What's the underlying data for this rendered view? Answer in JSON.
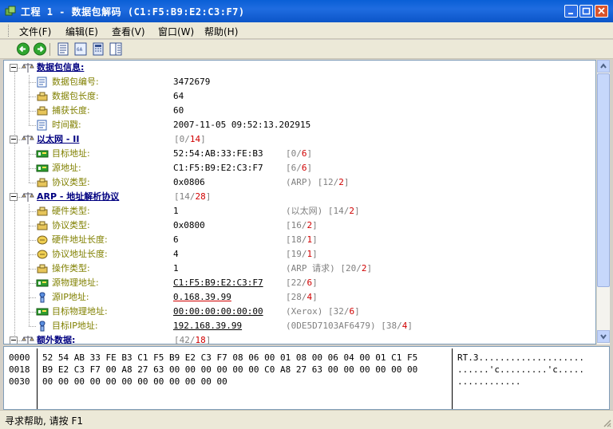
{
  "window": {
    "title": "工程 1 - 数据包解码 (C1:F5:B9:E2:C3:F7)",
    "buttons": [
      "minimize-icon",
      "maximize-icon",
      "close-icon"
    ]
  },
  "menubar": {
    "items": [
      "文件(F)",
      "编辑(E)",
      "查看(V)",
      "窗口(W)",
      "帮助(H)"
    ]
  },
  "toolbar": {
    "icons": [
      "back-arrow-icon",
      "forward-arrow-icon",
      "decode-view-icon",
      "hex-view-icon",
      "calculator-icon",
      "report-icon"
    ]
  },
  "tree": {
    "rows": [
      {
        "level": 0,
        "label": "数据包信息:",
        "value": "",
        "range": ""
      },
      {
        "level": 1,
        "label": "数据包编号:",
        "value": "3472679",
        "range": ""
      },
      {
        "level": 1,
        "label": "数据包长度:",
        "value": "64",
        "range": ""
      },
      {
        "level": 1,
        "label": "捕获长度:",
        "value": "60",
        "range": ""
      },
      {
        "level": 1,
        "label": "时间戳:",
        "value": "2007-11-05 09:52:13.202915",
        "range": ""
      },
      {
        "level": 0,
        "label": "以太网 - II",
        "value": "",
        "range": "[0/14]"
      },
      {
        "level": 1,
        "label": "目标地址:",
        "value": "52:54:AB:33:FE:B3",
        "range": "[0/6]"
      },
      {
        "level": 1,
        "label": "源地址:",
        "value": "C1:F5:B9:E2:C3:F7",
        "range": "[6/6]"
      },
      {
        "level": 1,
        "label": "协议类型:",
        "value": "0x0806",
        "range": "(ARP)  [12/2]"
      },
      {
        "level": 0,
        "label": "ARP - 地址解析协议",
        "value": "",
        "range": "[14/28]"
      },
      {
        "level": 1,
        "label": "硬件类型:",
        "value": "1",
        "range": "(以太网)  [14/2]"
      },
      {
        "level": 1,
        "label": "协议类型:",
        "value": "0x0800",
        "range": "[16/2]"
      },
      {
        "level": 1,
        "label": "硬件地址长度:",
        "value": "6",
        "range": "[18/1]"
      },
      {
        "level": 1,
        "label": "协议地址长度:",
        "value": "4",
        "range": "[19/1]"
      },
      {
        "level": 1,
        "label": "操作类型:",
        "value": "1",
        "range": "(ARP 请求)  [20/2]"
      },
      {
        "level": 1,
        "label": "源物理地址:",
        "value": "C1:F5:B9:E2:C3:F7",
        "range": "[22/6]"
      },
      {
        "level": 1,
        "label": "源IP地址:",
        "value": "0.168.39.99",
        "range": "[28/4]"
      },
      {
        "level": 1,
        "label": "目标物理地址:",
        "value": "00:00:00:00:00:00",
        "range": "(Xerox)  [32/6]"
      },
      {
        "level": 1,
        "label": "目标IP地址:",
        "value": "192.168.39.99",
        "range": "(0DE5D7103AF6479)  [38/4]"
      },
      {
        "level": 0,
        "label": "额外数据:",
        "value": "",
        "range": "[42/18]"
      }
    ]
  },
  "hex": {
    "offsets": [
      "0000",
      "0018",
      "0030"
    ],
    "bytes": [
      "52 54 AB 33 FE B3 C1 F5 B9 E2 C3 F7 08 06 00 01 08 00 06 04 00 01 C1 F5",
      "B9 E2 C3 F7 00 A8 27 63 00 00 00 00 00 00 C0 A8 27 63 00 00 00 00 00 00",
      "00 00 00 00 00 00 00 00 00 00 00 00"
    ],
    "ascii": [
      "RT.3....................",
      "......'c.........'c.....",
      "............"
    ]
  },
  "status": {
    "text": "寻求帮助, 请按 F1"
  }
}
